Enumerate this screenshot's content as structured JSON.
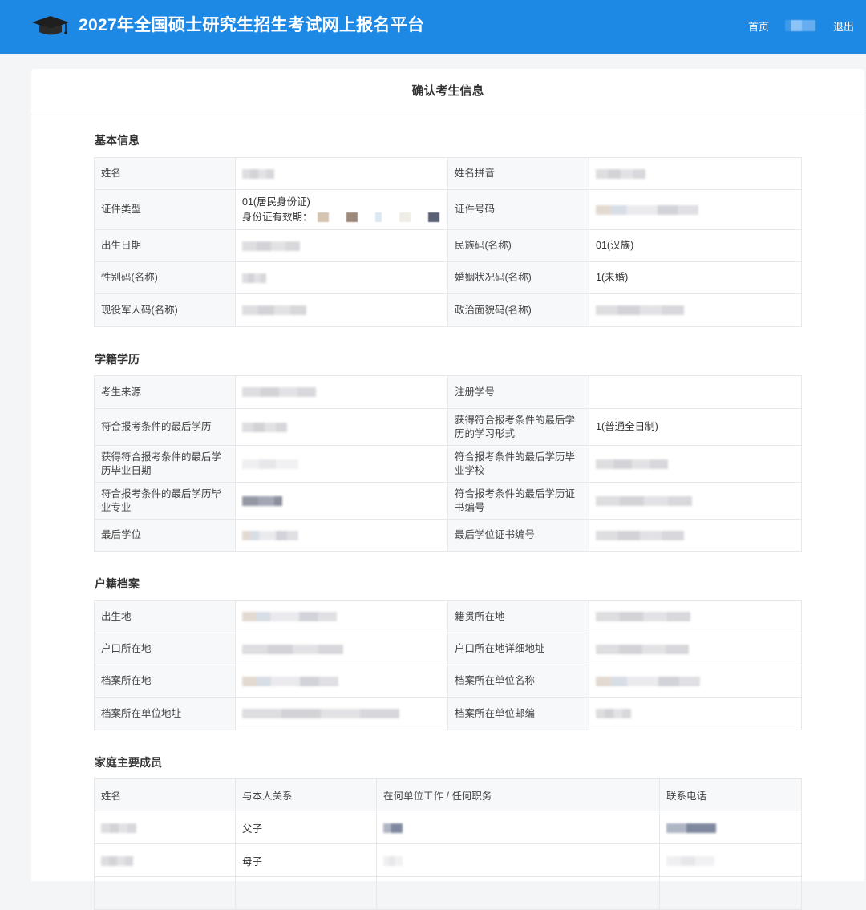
{
  "header": {
    "title": "2027年全国硕士研究生招生考试网上报名平台",
    "nav_home": "首页",
    "nav_logout": "退出"
  },
  "page": {
    "heading": "确认考生信息"
  },
  "basic": {
    "title": "基本信息",
    "name_label": "姓名",
    "pinyin_label": "姓名拼音",
    "id_type_label": "证件类型",
    "id_type_value": "01(居民身份证)",
    "id_valid_label": "身份证有效期：",
    "id_number_label": "证件号码",
    "birth_label": "出生日期",
    "ethnic_label": "民族码(名称)",
    "ethnic_value": "01(汉族)",
    "gender_label": "性别码(名称)",
    "marital_label": "婚姻状况码(名称)",
    "marital_value": "1(未婚)",
    "military_label": "现役军人码(名称)",
    "political_label": "政治面貌码(名称)"
  },
  "education": {
    "title": "学籍学历",
    "source_label": "考生来源",
    "regno_label": "注册学号",
    "degree_label": "符合报考条件的最后学历",
    "study_form_label": "获得符合报考条件的最后学历的学习形式",
    "study_form_value": "1(普通全日制)",
    "grad_date_label": "获得符合报考条件的最后学历毕业日期",
    "grad_school_label": "符合报考条件的最后学历毕业学校",
    "major_label": "符合报考条件的最后学历毕业专业",
    "cert_no_label": "符合报考条件的最后学历证书编号",
    "last_degree_label": "最后学位",
    "degree_cert_label": "最后学位证书编号"
  },
  "household": {
    "title": "户籍档案",
    "birthplace_label": "出生地",
    "native_label": "籍贯所在地",
    "hukou_label": "户口所在地",
    "hukou_detail_label": "户口所在地详细地址",
    "archive_loc_label": "档案所在地",
    "archive_unit_label": "档案所在单位名称",
    "archive_addr_label": "档案所在单位地址",
    "archive_zip_label": "档案所在单位邮编"
  },
  "family": {
    "title": "家庭主要成员",
    "columns": [
      "姓名",
      "与本人关系",
      "在何单位工作 / 任何职务",
      "联系电话"
    ],
    "rows": [
      {
        "relation": "父子"
      },
      {
        "relation": "母子"
      }
    ]
  }
}
